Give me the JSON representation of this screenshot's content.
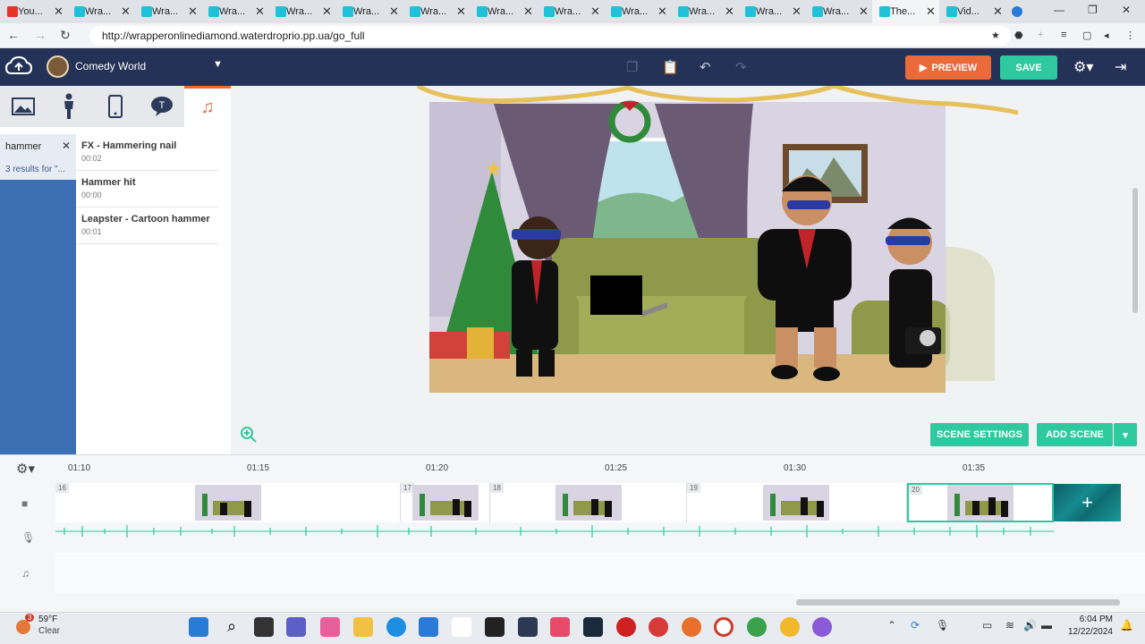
{
  "browser": {
    "tabs": [
      {
        "title": "You...",
        "icon": "youtube-icon",
        "color": "#e6332a"
      },
      {
        "title": "Wra...",
        "icon": "wrapper-icon",
        "color": "#1ec1d8"
      },
      {
        "title": "Wra...",
        "icon": "wrapper-icon",
        "color": "#1ec1d8"
      },
      {
        "title": "Wra...",
        "icon": "wrapper-icon",
        "color": "#1ec1d8"
      },
      {
        "title": "Wra...",
        "icon": "wrapper-icon",
        "color": "#1ec1d8"
      },
      {
        "title": "Wra...",
        "icon": "wrapper-icon",
        "color": "#1ec1d8"
      },
      {
        "title": "Wra...",
        "icon": "wrapper-icon",
        "color": "#1ec1d8"
      },
      {
        "title": "Wra...",
        "icon": "wrapper-icon",
        "color": "#1ec1d8"
      },
      {
        "title": "Wra...",
        "icon": "wrapper-icon",
        "color": "#1ec1d8"
      },
      {
        "title": "Wra...",
        "icon": "wrapper-icon",
        "color": "#1ec1d8"
      },
      {
        "title": "Wra...",
        "icon": "wrapper-icon",
        "color": "#1ec1d8"
      },
      {
        "title": "Wra...",
        "icon": "wrapper-icon",
        "color": "#1ec1d8"
      },
      {
        "title": "Wra...",
        "icon": "wrapper-icon",
        "color": "#1ec1d8"
      },
      {
        "title": "The...",
        "icon": "wrapper-icon",
        "color": "#1ec1d8",
        "active": true
      },
      {
        "title": "Vid...",
        "icon": "wrapper-icon",
        "color": "#1ec1d8"
      }
    ],
    "url": "http://wrapperonlinediamond.waterdroprio.pp.ua/go_full"
  },
  "header": {
    "theme_name": "Comedy World",
    "preview_label": "PREVIEW",
    "save_label": "SAVE",
    "accent": "#ea6a3a",
    "save_color": "#2fc9a0"
  },
  "library": {
    "tabs": [
      "background-tab",
      "character-tab",
      "prop-tab",
      "text-tab",
      "sound-tab"
    ],
    "search_value": "hammer",
    "results_label": "3 results for \"...",
    "sounds": [
      {
        "name": "FX - Hammering nail",
        "duration": "00:02"
      },
      {
        "name": "Hammer hit",
        "duration": "00:00"
      },
      {
        "name": "Leapster - Cartoon hammer",
        "duration": "00:01"
      }
    ]
  },
  "stage": {
    "scene_settings_label": "SCENE SETTINGS",
    "add_scene_label": "ADD SCENE"
  },
  "timeline": {
    "ruler": [
      "01:10",
      "01:15",
      "01:20",
      "01:25",
      "01:30",
      "01:35"
    ],
    "scenes": [
      "16",
      "17",
      "18",
      "19",
      "20"
    ]
  },
  "taskbar": {
    "weather_badge": "3",
    "temperature": "59°F",
    "condition": "Clear",
    "time": "6:04 PM",
    "date": "12/22/2024"
  }
}
